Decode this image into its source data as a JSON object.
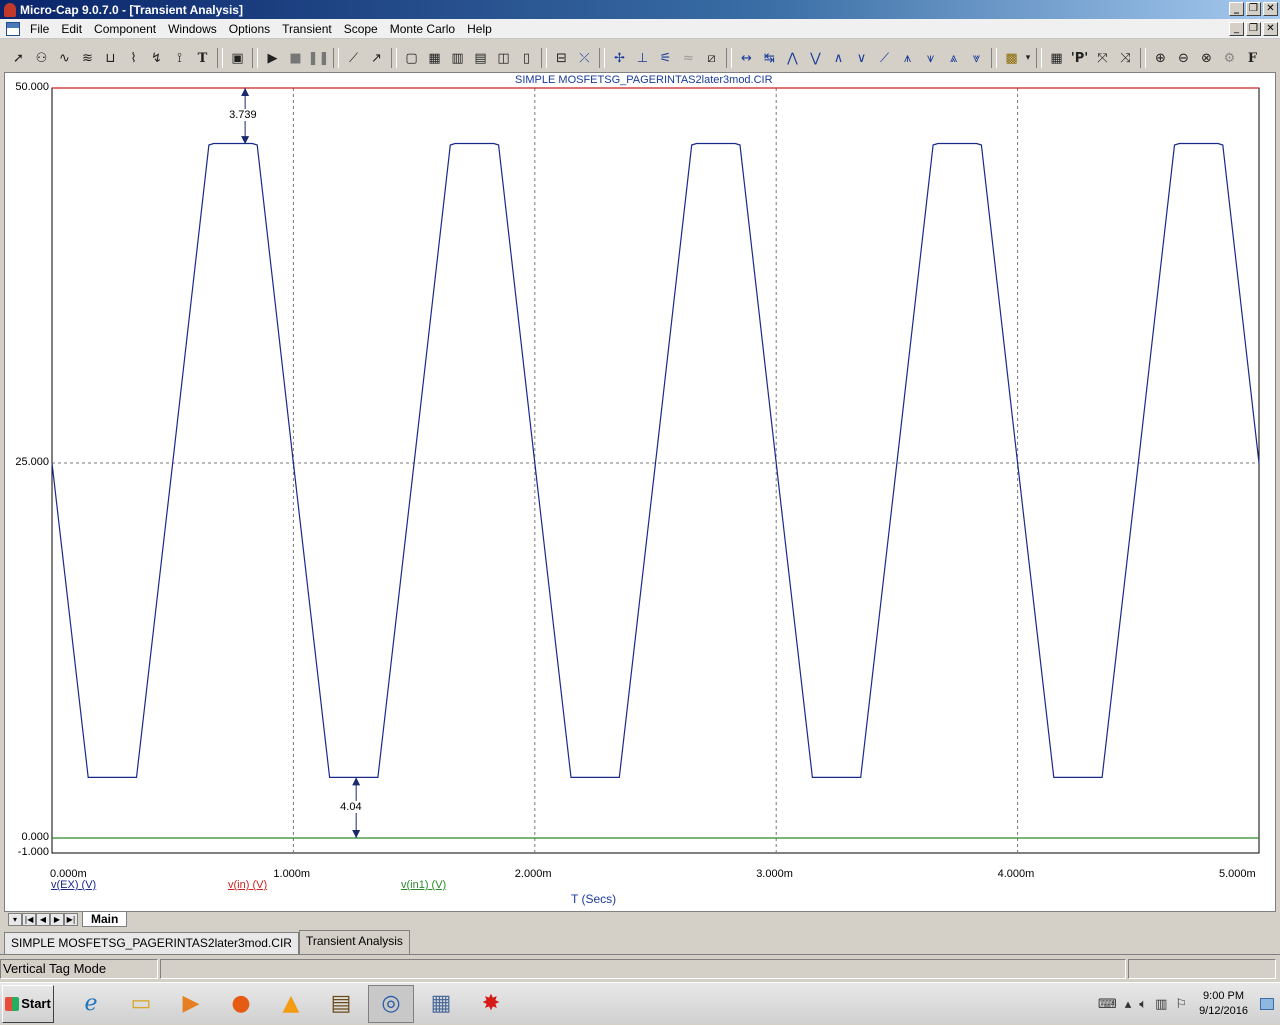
{
  "window": {
    "title": "Micro-Cap 9.0.7.0 - [Transient Analysis]"
  },
  "menu": {
    "items": [
      "File",
      "Edit",
      "Component",
      "Windows",
      "Options",
      "Transient",
      "Scope",
      "Monte Carlo",
      "Help"
    ]
  },
  "toolbar": {
    "icons": [
      "select-arrow-icon",
      "component-icon",
      "wave-icon",
      "tagwave-icon",
      "bracket-icon",
      "pin-icon",
      "pointtag-icon",
      "text-icon",
      "properties-icon",
      "run-icon",
      "stop-icon",
      "pause-icon",
      "line-icon",
      "diagonal-line-icon",
      "frame-icon",
      "grid-icon",
      "minor-grid-icon",
      "axes-icon",
      "table-icon",
      "ruler-icon",
      "scale-icon",
      "cursor-peak-icon",
      "cursor-valley-icon",
      "cursor-slope-icon",
      "cursor-wave-icon",
      "toggle-icon",
      "tag-horizontal-icon",
      "tag-vertical-icon",
      "peak-icon",
      "valley-icon",
      "high-icon",
      "low-icon",
      "inflection-icon",
      "global-high-icon",
      "global-low-icon",
      "top-icon",
      "bottom-icon",
      "color-icon",
      "table2-icon",
      "p-icon",
      "xscale-icon",
      "yscale-icon",
      "zoom-in-icon",
      "zoom-out-icon",
      "zoom-fit-icon",
      "settings-icon",
      "f-icon"
    ]
  },
  "chart_data": {
    "type": "line",
    "title": "SIMPLE MOSFETSG_PAGERINTAS2later3mod.CIR",
    "xlabel": "T (Secs)",
    "ylabel": "",
    "xlim": [
      0,
      5.0
    ],
    "ylim": [
      -1.0,
      50.0
    ],
    "x_unit": "m",
    "x_tick_labels": [
      "0.000m",
      "1.000m",
      "2.000m",
      "3.000m",
      "4.000m",
      "5.000m"
    ],
    "y_tick_labels": [
      "50.000",
      "25.000",
      "0.000",
      "-1.000"
    ],
    "y_ticks": [
      50.0,
      25.0,
      0.0,
      -1.0
    ],
    "grid": true,
    "series": [
      {
        "name": "v(EX) (V)",
        "color": "#1a2a8a",
        "x": [
          0.0,
          0.15,
          0.17,
          0.33,
          0.35,
          0.5,
          0.65,
          0.67,
          0.83,
          0.85,
          1.0,
          1.15,
          1.17,
          1.33,
          1.35,
          1.5,
          1.65,
          1.67,
          1.83,
          1.85,
          2.0,
          2.15,
          2.17,
          2.33,
          2.35,
          2.5,
          2.65,
          2.67,
          2.83,
          2.85,
          3.0,
          3.15,
          3.17,
          3.33,
          3.35,
          3.5,
          3.65,
          3.67,
          3.83,
          3.85,
          4.0,
          4.15,
          4.17,
          4.33,
          4.35,
          4.5,
          4.65,
          4.67,
          4.83,
          4.85,
          5.0
        ],
        "values": [
          25.0,
          4.04,
          4.04,
          4.04,
          4.04,
          25.0,
          46.2,
          46.3,
          46.3,
          46.2,
          25.0,
          4.04,
          4.04,
          4.04,
          4.04,
          25.0,
          46.2,
          46.3,
          46.3,
          46.2,
          25.0,
          4.04,
          4.04,
          4.04,
          4.04,
          25.0,
          46.2,
          46.3,
          46.3,
          46.2,
          25.0,
          4.04,
          4.04,
          4.04,
          4.04,
          25.0,
          46.2,
          46.3,
          46.3,
          46.2,
          25.0,
          4.04,
          4.04,
          4.04,
          4.04,
          25.0,
          46.2,
          46.3,
          46.3,
          46.2,
          25.0
        ]
      },
      {
        "name": "v(in) (V)",
        "color": "#cc2222",
        "x": [
          0.0,
          5.0
        ],
        "values": [
          50.0,
          50.0
        ]
      },
      {
        "name": "v(in1) (V)",
        "color": "#2a8a2a",
        "x": [
          0.0,
          5.0
        ],
        "values": [
          0.0,
          0.0
        ]
      }
    ],
    "tags": [
      {
        "label": "3.739",
        "x": 0.8,
        "y_from": 50.0,
        "y_to": 46.261
      },
      {
        "label": "4.04",
        "x": 1.26,
        "y_from": 4.04,
        "y_to": 0.0
      }
    ]
  },
  "pager": {
    "buttons": [
      "▾",
      "|◀",
      "◀",
      "▶",
      "▶|"
    ],
    "tab": "Main"
  },
  "doc_tabs": [
    "SIMPLE MOSFETSG_PAGERINTAS2later3mod.CIR",
    "Transient Analysis"
  ],
  "status": {
    "mode": "Vertical Tag Mode"
  },
  "taskbar": {
    "start": "Start",
    "apps": [
      "ie-icon",
      "explorer-icon",
      "media-player-icon",
      "firefox-icon",
      "vlc-icon",
      "archive-icon",
      "microcap-icon",
      "calculator-icon",
      "paint-splat-icon"
    ],
    "clock_time": "9:00 PM",
    "clock_date": "9/12/2016"
  }
}
